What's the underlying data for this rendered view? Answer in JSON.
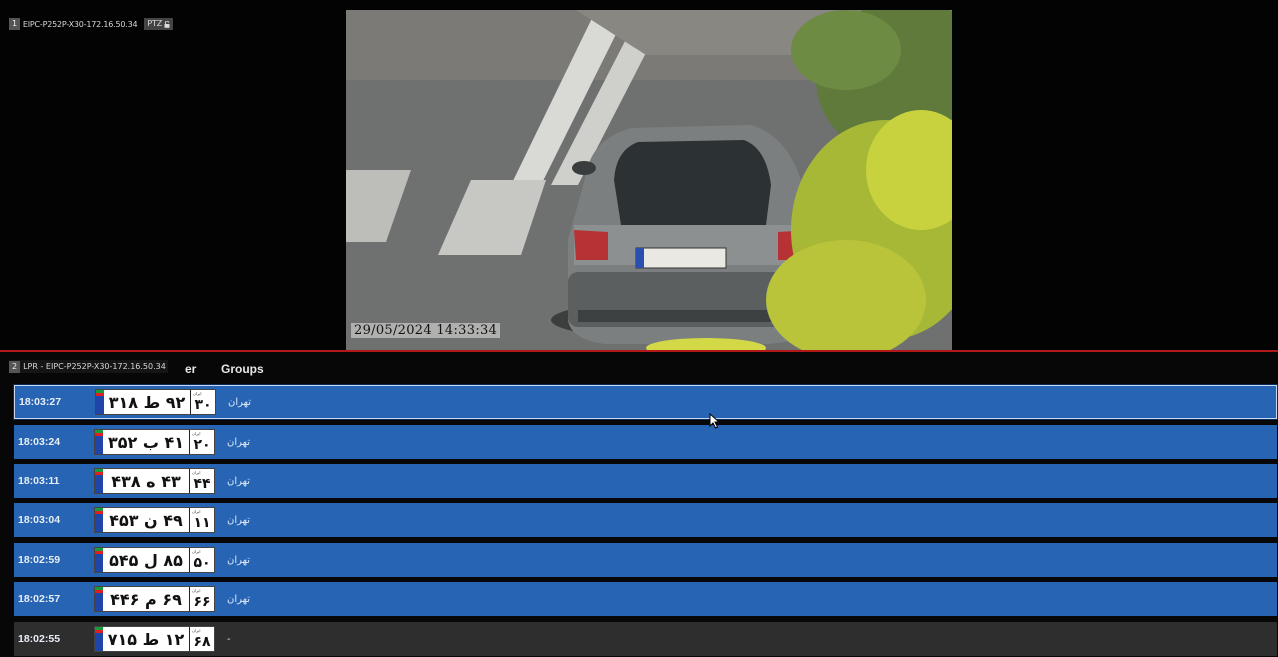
{
  "pane1": {
    "index": "1",
    "camera_name": "EIPC-P252P-X30-172.16.50.34",
    "ptz_label": "PTZ",
    "ptz_icon": "lock-open-icon",
    "video_timestamp": "29/05/2024 14:33:34"
  },
  "pane2": {
    "index": "2",
    "title": "LPR - EIPC-P252P-X30-172.16.50.34",
    "header_partial": "er",
    "header_groups": "Groups"
  },
  "colors": {
    "row_blue": "#2765b4",
    "row_gray": "#2e2e2e",
    "divider_red": "#b11818"
  },
  "rows": [
    {
      "time": "18:03:27",
      "plate_main": "۹۲ ط ۳۱۸",
      "plate_region": "۳۰",
      "group": "تهران",
      "selected": true
    },
    {
      "time": "18:03:24",
      "plate_main": "۴۱ ب ۳۵۲",
      "plate_region": "۲۰",
      "group": "تهران"
    },
    {
      "time": "18:03:11",
      "plate_main": "۴۳ ه ۴۳۸",
      "plate_region": "۴۴",
      "group": "تهران"
    },
    {
      "time": "18:03:04",
      "plate_main": "۴۹ ن ۴۵۳",
      "plate_region": "۱۱",
      "group": "تهران"
    },
    {
      "time": "18:02:59",
      "plate_main": "۸۵ ل ۵۴۵",
      "plate_region": "۵۰",
      "group": "تهران"
    },
    {
      "time": "18:02:57",
      "plate_main": "۶۹ م ۴۴۶",
      "plate_region": "۶۶",
      "group": "تهران"
    },
    {
      "time": "18:02:55",
      "plate_main": "۱۲ ط ۷۱۵",
      "plate_region": "۶۸",
      "group": "-"
    }
  ],
  "plate_caption": "ایران"
}
